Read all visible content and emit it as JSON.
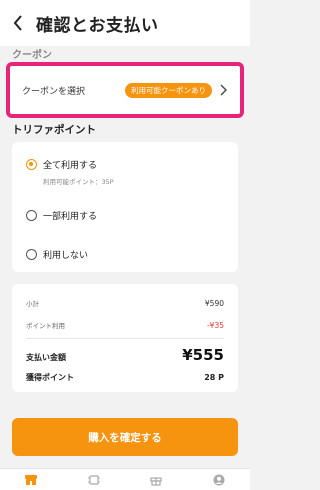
{
  "header": {
    "title": "確認とお支払い"
  },
  "coupon": {
    "section_label": "クーポン",
    "select_label": "クーポンを選択",
    "badge": "利用可能クーポンあり"
  },
  "points": {
    "section_label": "トリファポイント",
    "options": [
      {
        "label": "全て利用する",
        "sub": "利用可能ポイント：35P",
        "selected": true
      },
      {
        "label": "一部利用する",
        "selected": false
      },
      {
        "label": "利用しない",
        "selected": false
      }
    ]
  },
  "summary": {
    "subtotal_label": "小計",
    "subtotal_value": "¥590",
    "points_used_label": "ポイント利用",
    "points_used_value": "-¥35",
    "total_label": "支払い金額",
    "total_value": "¥555",
    "earned_label": "獲得ポイント",
    "earned_value": "28 P"
  },
  "confirm_button": "購入を確定する",
  "colors": {
    "accent": "#f6930f",
    "highlight": "#e5247a",
    "negative": "#e53935"
  },
  "tabbar": {
    "icons": [
      "store-icon",
      "chip-icon",
      "gift-icon",
      "profile-icon"
    ],
    "active": 0
  }
}
